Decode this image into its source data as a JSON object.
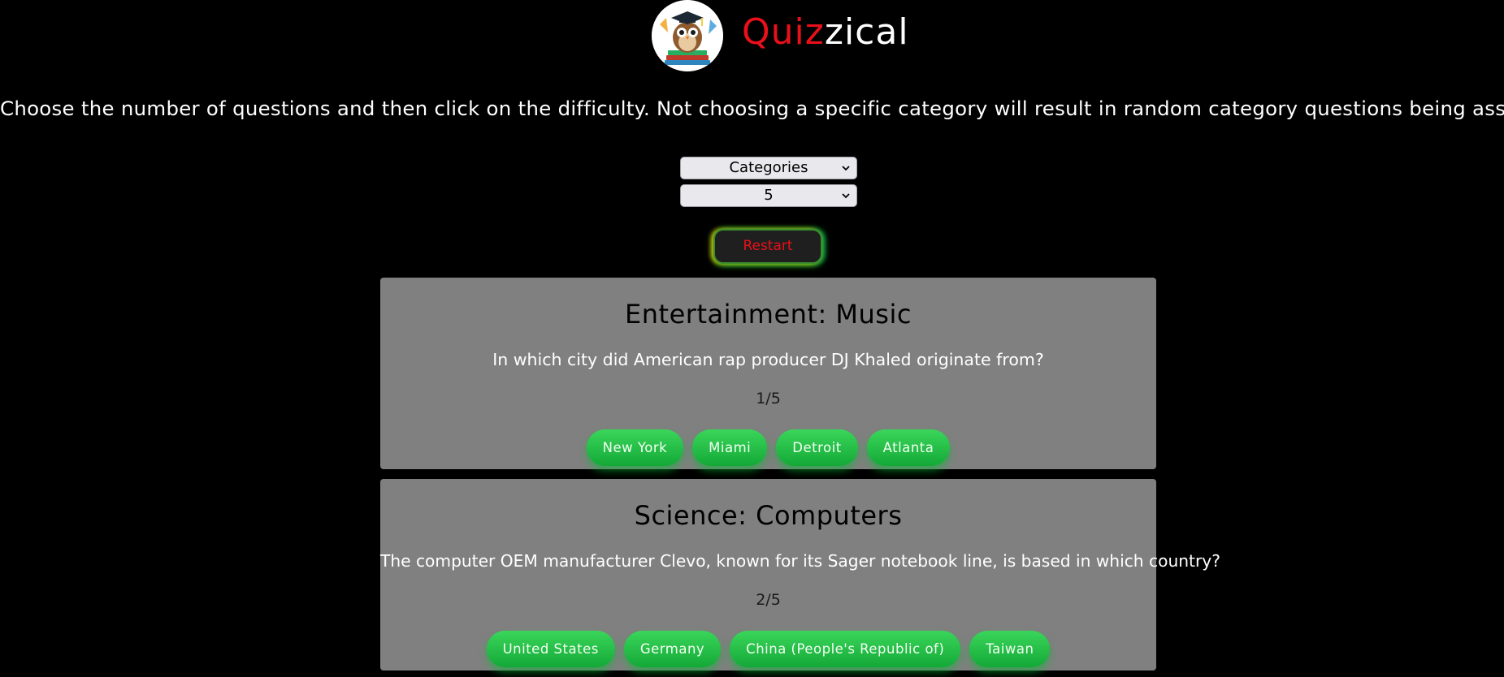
{
  "header": {
    "logo_icon": "owl-graduate-logo",
    "title_accent": "Quiz",
    "title_rest": "zical",
    "title_accent_color": "#e8101a"
  },
  "instructions": "Choose the number of questions and then click on the difficulty. Not choosing a specific category will result in random category questions being assigned.",
  "controls": {
    "category_select": "Categories",
    "count_select": "5",
    "restart_label": "Restart"
  },
  "questions": [
    {
      "category": "Entertainment: Music",
      "question": "In which city did American rap producer DJ Khaled originate from?",
      "counter": "1/5",
      "answers": [
        "New York",
        "Miami",
        "Detroit",
        "Atlanta"
      ]
    },
    {
      "category": "Science: Computers",
      "question": "The computer OEM manufacturer Clevo, known for its Sager notebook line, is based in which country?",
      "counter": "2/5",
      "answers": [
        "United States",
        "Germany",
        "China (People's Republic of)",
        "Taiwan"
      ]
    }
  ],
  "colors": {
    "background": "#000000",
    "card": "#808080",
    "answer_green": "#22c046",
    "restart_text": "#e8101a"
  }
}
